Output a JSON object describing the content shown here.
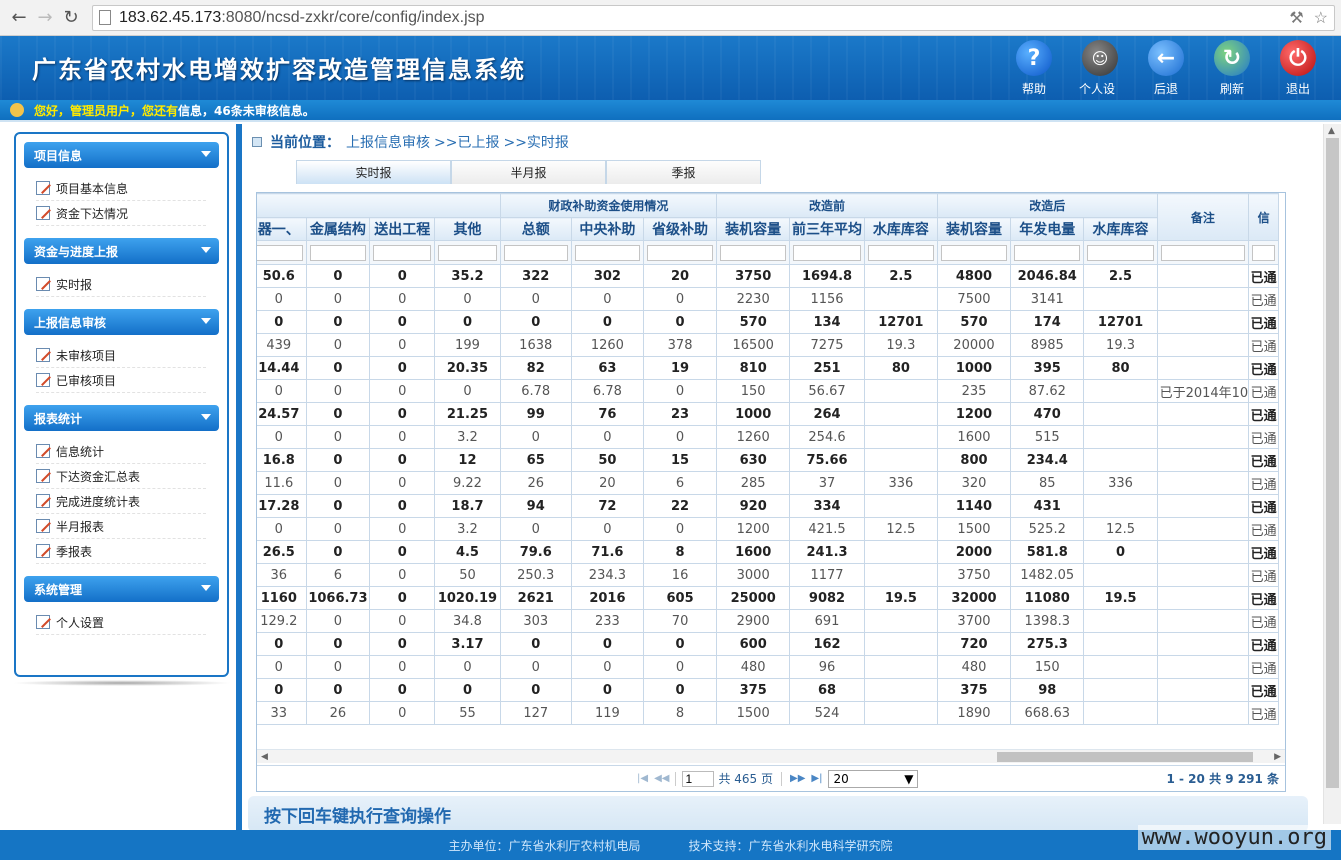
{
  "browser": {
    "url_host": "183.62.45.173",
    "url_rest": ":8080/ncsd-zxkr/core/config/index.jsp"
  },
  "app": {
    "title": "广东省农村水电增效扩容改造管理信息系统",
    "tools": [
      {
        "label": "帮助",
        "icon": "help-icon"
      },
      {
        "label": "个人设置",
        "icon": "user-settings-icon"
      },
      {
        "label": "后退",
        "icon": "back-icon"
      },
      {
        "label": "刷新",
        "icon": "refresh-icon"
      },
      {
        "label": "退出",
        "icon": "logout-icon"
      }
    ],
    "notice_greet": "您好，管理员用户，您还有",
    "notice_count": "信息，46条未审核信息。"
  },
  "sidebar": {
    "groups": [
      {
        "title": "项目信息",
        "items": [
          "项目基本信息",
          "资金下达情况"
        ]
      },
      {
        "title": "资金与进度上报",
        "items": [
          "实时报"
        ]
      },
      {
        "title": "上报信息审核",
        "items": [
          "未审核项目",
          "已审核项目"
        ]
      },
      {
        "title": "报表统计",
        "items": [
          "信息统计",
          "下达资金汇总表",
          "完成进度统计表",
          "半月报表",
          "季报表"
        ]
      },
      {
        "title": "系统管理",
        "items": [
          "个人设置"
        ]
      }
    ]
  },
  "breadcrumb": {
    "label": "当前位置：",
    "p1": "上报信息审核",
    "p2": ">>已上报",
    "p3": ">>实时报"
  },
  "tabs": [
    "实时报",
    "半月报",
    "季报"
  ],
  "grid": {
    "group_headers": {
      "finance": "财政补助资金使用情况",
      "before": "改造前",
      "after": "改造后"
    },
    "columns": [
      "器一、",
      "金属结构",
      "送出工程",
      "其他",
      "总额",
      "中央补助",
      "省级补助",
      "装机容量",
      "前三年平均",
      "水库库容",
      "装机容量",
      "年发电量",
      "水库库容",
      "备注",
      "信"
    ],
    "rows": [
      [
        "50.6",
        "0",
        "0",
        "35.2",
        "322",
        "302",
        "20",
        "3750",
        "1694.8",
        "2.5",
        "4800",
        "2046.84",
        "2.5",
        "",
        "已通"
      ],
      [
        "0",
        "0",
        "0",
        "0",
        "0",
        "0",
        "0",
        "2230",
        "1156",
        "",
        "7500",
        "3141",
        "",
        "",
        "已通"
      ],
      [
        "0",
        "0",
        "0",
        "0",
        "0",
        "0",
        "0",
        "570",
        "134",
        "12701",
        "570",
        "174",
        "12701",
        "",
        "已通"
      ],
      [
        "439",
        "0",
        "0",
        "199",
        "1638",
        "1260",
        "378",
        "16500",
        "7275",
        "19.3",
        "20000",
        "8985",
        "19.3",
        "",
        "已通"
      ],
      [
        "14.44",
        "0",
        "0",
        "20.35",
        "82",
        "63",
        "19",
        "810",
        "251",
        "80",
        "1000",
        "395",
        "80",
        "",
        "已通"
      ],
      [
        "0",
        "0",
        "0",
        "0",
        "6.78",
        "6.78",
        "0",
        "150",
        "56.67",
        "",
        "235",
        "87.62",
        "",
        "已于2014年10",
        "已通"
      ],
      [
        "24.57",
        "0",
        "0",
        "21.25",
        "99",
        "76",
        "23",
        "1000",
        "264",
        "",
        "1200",
        "470",
        "",
        "",
        "已通"
      ],
      [
        "0",
        "0",
        "0",
        "3.2",
        "0",
        "0",
        "0",
        "1260",
        "254.6",
        "",
        "1600",
        "515",
        "",
        "",
        "已通"
      ],
      [
        "16.8",
        "0",
        "0",
        "12",
        "65",
        "50",
        "15",
        "630",
        "75.66",
        "",
        "800",
        "234.4",
        "",
        "",
        "已通"
      ],
      [
        "11.6",
        "0",
        "0",
        "9.22",
        "26",
        "20",
        "6",
        "285",
        "37",
        "336",
        "320",
        "85",
        "336",
        "",
        "已通"
      ],
      [
        "17.28",
        "0",
        "0",
        "18.7",
        "94",
        "72",
        "22",
        "920",
        "334",
        "",
        "1140",
        "431",
        "",
        "",
        "已通"
      ],
      [
        "0",
        "0",
        "0",
        "3.2",
        "0",
        "0",
        "0",
        "1200",
        "421.5",
        "12.5",
        "1500",
        "525.2",
        "12.5",
        "",
        "已通"
      ],
      [
        "26.5",
        "0",
        "0",
        "4.5",
        "79.6",
        "71.6",
        "8",
        "1600",
        "241.3",
        "",
        "2000",
        "581.8",
        "0",
        "",
        "已通"
      ],
      [
        "36",
        "6",
        "0",
        "50",
        "250.3",
        "234.3",
        "16",
        "3000",
        "1177",
        "",
        "3750",
        "1482.05",
        "",
        "",
        "已通"
      ],
      [
        "1160",
        "1066.73",
        "0",
        "1020.19",
        "2621",
        "2016",
        "605",
        "25000",
        "9082",
        "19.5",
        "32000",
        "11080",
        "19.5",
        "",
        "已通"
      ],
      [
        "129.2",
        "0",
        "0",
        "34.8",
        "303",
        "233",
        "70",
        "2900",
        "691",
        "",
        "3700",
        "1398.3",
        "",
        "",
        "已通"
      ],
      [
        "0",
        "0",
        "0",
        "3.17",
        "0",
        "0",
        "0",
        "600",
        "162",
        "",
        "720",
        "275.3",
        "",
        "",
        "已通"
      ],
      [
        "0",
        "0",
        "0",
        "0",
        "0",
        "0",
        "0",
        "480",
        "96",
        "",
        "480",
        "150",
        "",
        "",
        "已通"
      ],
      [
        "0",
        "0",
        "0",
        "0",
        "0",
        "0",
        "0",
        "375",
        "68",
        "",
        "375",
        "98",
        "",
        "",
        "已通"
      ],
      [
        "33",
        "26",
        "0",
        "55",
        "127",
        "119",
        "8",
        "1500",
        "524",
        "",
        "1890",
        "668.63",
        "",
        "",
        "已通"
      ]
    ]
  },
  "pager": {
    "page": "1",
    "total_pages": "共 465 页",
    "page_size": "20",
    "summary": "1 - 20   共 9 291 条"
  },
  "hint": "按下回车键执行查询操作",
  "footer": {
    "sponsor": "主办单位：广东省水利厅农村机电局",
    "support": "技术支持：广东省水利水电科学研究院"
  },
  "watermark": "www.wooyun.org"
}
